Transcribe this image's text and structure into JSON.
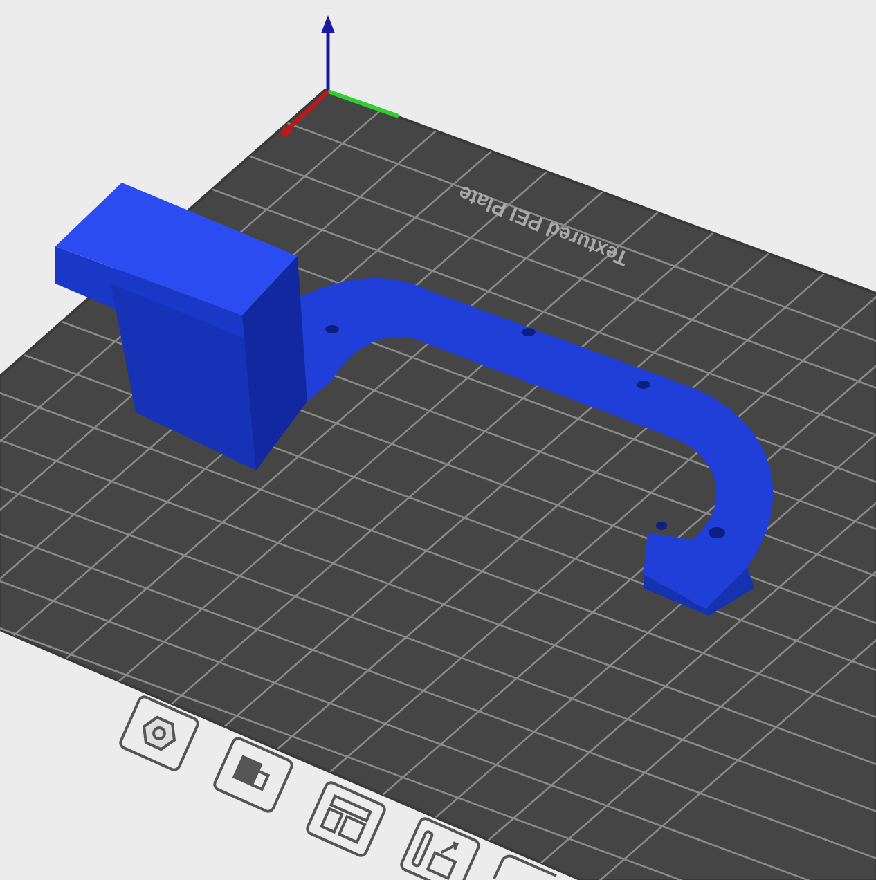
{
  "plate": {
    "label": "Textured PEI Plate"
  }
}
